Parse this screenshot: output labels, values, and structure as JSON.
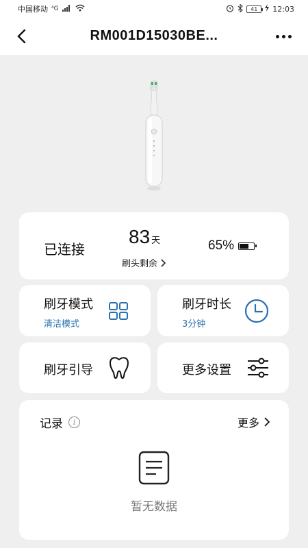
{
  "status_bar": {
    "carrier": "中国移动",
    "network": "⁴G",
    "battery": "41",
    "time": "12:03"
  },
  "header": {
    "title": "RM001D15030BE...",
    "back_icon": "chevron-left-icon",
    "more_icon": "more-dots-icon"
  },
  "status_card": {
    "connection": "已连接",
    "days_value": "83",
    "days_unit": "天",
    "head_remaining_label": "刷头剩余",
    "battery_percent": "65%",
    "battery_level": 0.65
  },
  "tiles": {
    "mode": {
      "title": "刷牙模式",
      "value": "清洁模式",
      "icon": "grid-icon"
    },
    "duration": {
      "title": "刷牙时长",
      "value": "3分钟",
      "icon": "clock-icon"
    },
    "guide": {
      "title": "刷牙引导",
      "icon": "tooth-icon"
    },
    "settings": {
      "title": "更多设置",
      "icon": "sliders-icon"
    }
  },
  "records": {
    "title": "记录",
    "info_glyph": "i",
    "more_label": "更多",
    "empty_text": "暂无数据"
  },
  "colors": {
    "accent": "#2a6fb0",
    "background": "#efefef",
    "card": "#ffffff"
  }
}
